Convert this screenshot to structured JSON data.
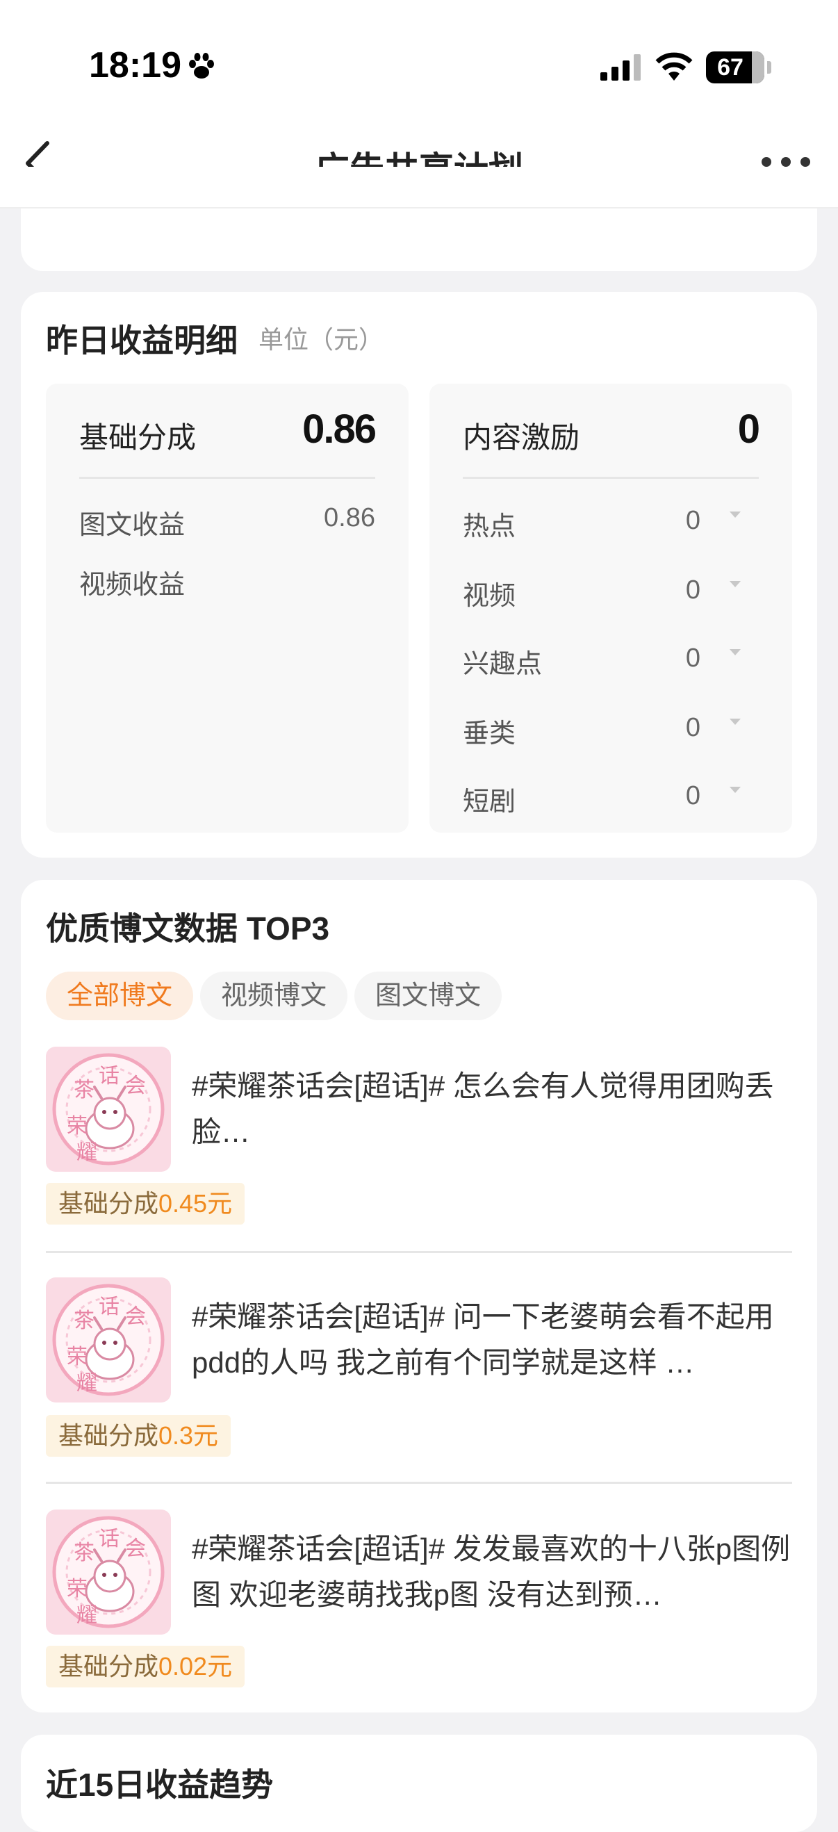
{
  "status_bar": {
    "time": "18:19",
    "battery": "67"
  },
  "nav": {
    "title": "广告共享计划"
  },
  "yesterday": {
    "title": "昨日收益明细",
    "unit": "单位（元）",
    "basic": {
      "label": "基础分成",
      "value": "0.86",
      "rows": [
        {
          "label": "图文收益",
          "value": "0.86"
        },
        {
          "label": "视频收益",
          "value": ""
        }
      ]
    },
    "content": {
      "label": "内容激励",
      "value": "0",
      "rows": [
        {
          "label": "热点",
          "value": "0"
        },
        {
          "label": "视频",
          "value": "0"
        },
        {
          "label": "兴趣点",
          "value": "0"
        },
        {
          "label": "垂类",
          "value": "0"
        },
        {
          "label": "短剧",
          "value": "0"
        }
      ]
    }
  },
  "top3": {
    "title": "优质博文数据 TOP3",
    "tabs": [
      {
        "label": "全部博文",
        "active": true
      },
      {
        "label": "视频博文",
        "active": false
      },
      {
        "label": "图文博文",
        "active": false
      }
    ],
    "posts": [
      {
        "text": "#荣耀茶话会[超话]# 怎么会有人觉得用团购丢脸…",
        "badge_label": "基础分成",
        "badge_amount": "0.45元"
      },
      {
        "text": "#荣耀茶话会[超话]# 问一下老婆萌会看不起用pdd的人吗 我之前有个同学就是这样 …",
        "badge_label": "基础分成",
        "badge_amount": "0.3元"
      },
      {
        "text": "#荣耀茶话会[超话]# 发发最喜欢的十八张p图例图 欢迎老婆萌找我p图 没有达到预…",
        "badge_label": "基础分成",
        "badge_amount": "0.02元"
      }
    ],
    "thumb_text": [
      "茶",
      "话",
      "会",
      "荣",
      "耀"
    ]
  },
  "trend": {
    "title": "近15日收益趋势"
  }
}
